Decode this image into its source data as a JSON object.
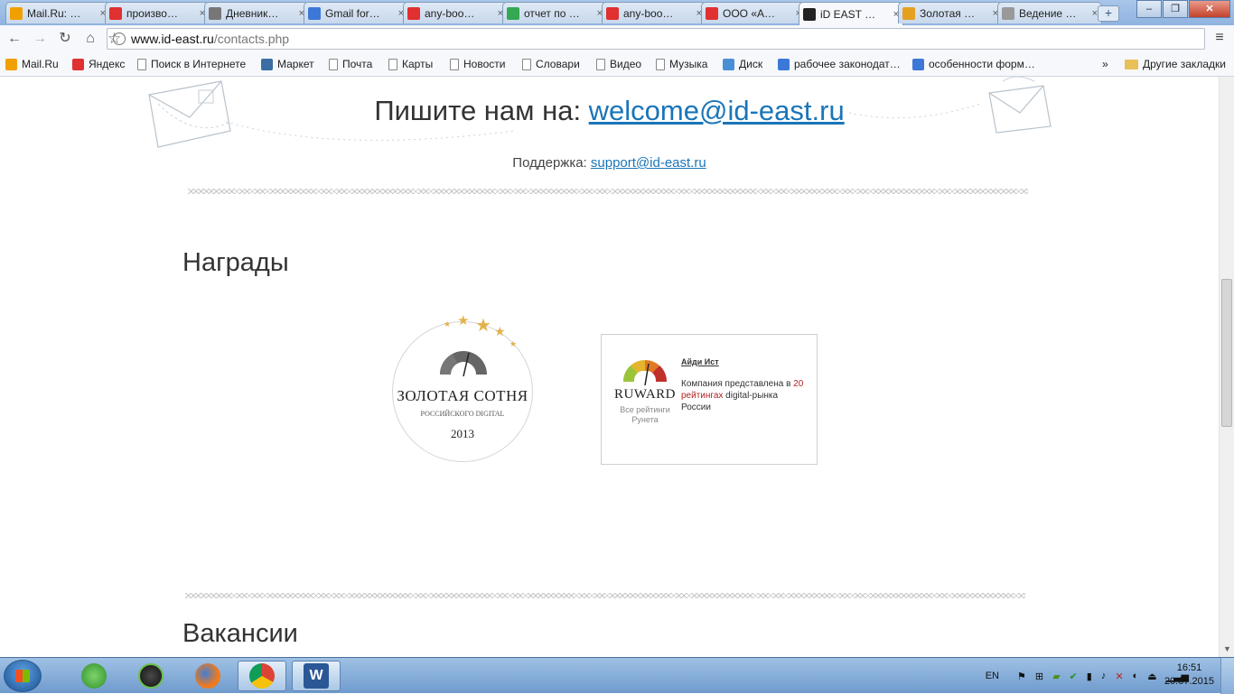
{
  "tabs": [
    {
      "label": "Mail.Ru: …",
      "icon": "mailru-icon",
      "color": "#f0a000"
    },
    {
      "label": "произво…",
      "icon": "yandex-icon",
      "color": "#e03030"
    },
    {
      "label": "Дневник…",
      "icon": "pencil-icon",
      "color": "#777777"
    },
    {
      "label": "Gmail for…",
      "icon": "google-icon",
      "color": "#3c78d8"
    },
    {
      "label": "any-boo…",
      "icon": "yandex-icon",
      "color": "#e03030"
    },
    {
      "label": "отчет по …",
      "icon": "google-drive-icon",
      "color": "#34a853"
    },
    {
      "label": "any-boo…",
      "icon": "yandex-icon",
      "color": "#e03030"
    },
    {
      "label": "ООО «А…",
      "icon": "yandex-icon",
      "color": "#e03030"
    },
    {
      "label": "iD EAST …",
      "icon": "id-east-icon",
      "color": "#222222"
    },
    {
      "label": "Золотая …",
      "icon": "rainbow-icon",
      "color": "#e5a020"
    },
    {
      "label": "Ведение …",
      "icon": "page-icon",
      "color": "#999999"
    }
  ],
  "active_tab_index": 8,
  "address": {
    "host": "www.id-east.ru",
    "path": "/contacts.php"
  },
  "bookmarks": [
    {
      "label": "Mail.Ru",
      "icon": "mailru-icon"
    },
    {
      "label": "Яндекс",
      "icon": "yandex-icon"
    },
    {
      "label": "Поиск в Интернете",
      "icon": "page-icon"
    },
    {
      "label": "Маркет",
      "icon": "market-icon"
    },
    {
      "label": "Почта",
      "icon": "page-icon"
    },
    {
      "label": "Карты",
      "icon": "page-icon"
    },
    {
      "label": "Новости",
      "icon": "page-icon"
    },
    {
      "label": "Словари",
      "icon": "page-icon"
    },
    {
      "label": "Видео",
      "icon": "page-icon"
    },
    {
      "label": "Музыка",
      "icon": "page-icon"
    },
    {
      "label": "Диск",
      "icon": "disk-icon"
    },
    {
      "label": "рабочее законодат…",
      "icon": "google-icon"
    },
    {
      "label": "особенности форм…",
      "icon": "google-icon"
    }
  ],
  "bookmarks_overflow": "»",
  "other_bookmarks": "Другие закладки",
  "page": {
    "contact_prefix": "Пишите нам на: ",
    "contact_email": "welcome@id-east.ru",
    "support_prefix": "Поддержка: ",
    "support_email": "support@id-east.ru",
    "awards_title": "Награды",
    "vacancies_title": "Вакансии",
    "gold": {
      "title": "ЗОЛОТАЯ СОТНЯ",
      "subtitle": "РОССИЙСКОГО DIGITAL",
      "year": "2013"
    },
    "ruward": {
      "logo": "RUWARD",
      "sub": "Все рейтинги Рунета",
      "name": "Айди Ист",
      "text_1": "Компания представлена в ",
      "text_highlight": "20 рейтингах",
      "text_2": " digital-рынка России"
    }
  },
  "taskbar": {
    "lang": "EN",
    "time": "16:51",
    "date": "20.07.2015"
  },
  "colors": {
    "link": "#1a75b8",
    "accent_gold": "#e2b24a",
    "ruward_highlight": "#b22222"
  }
}
